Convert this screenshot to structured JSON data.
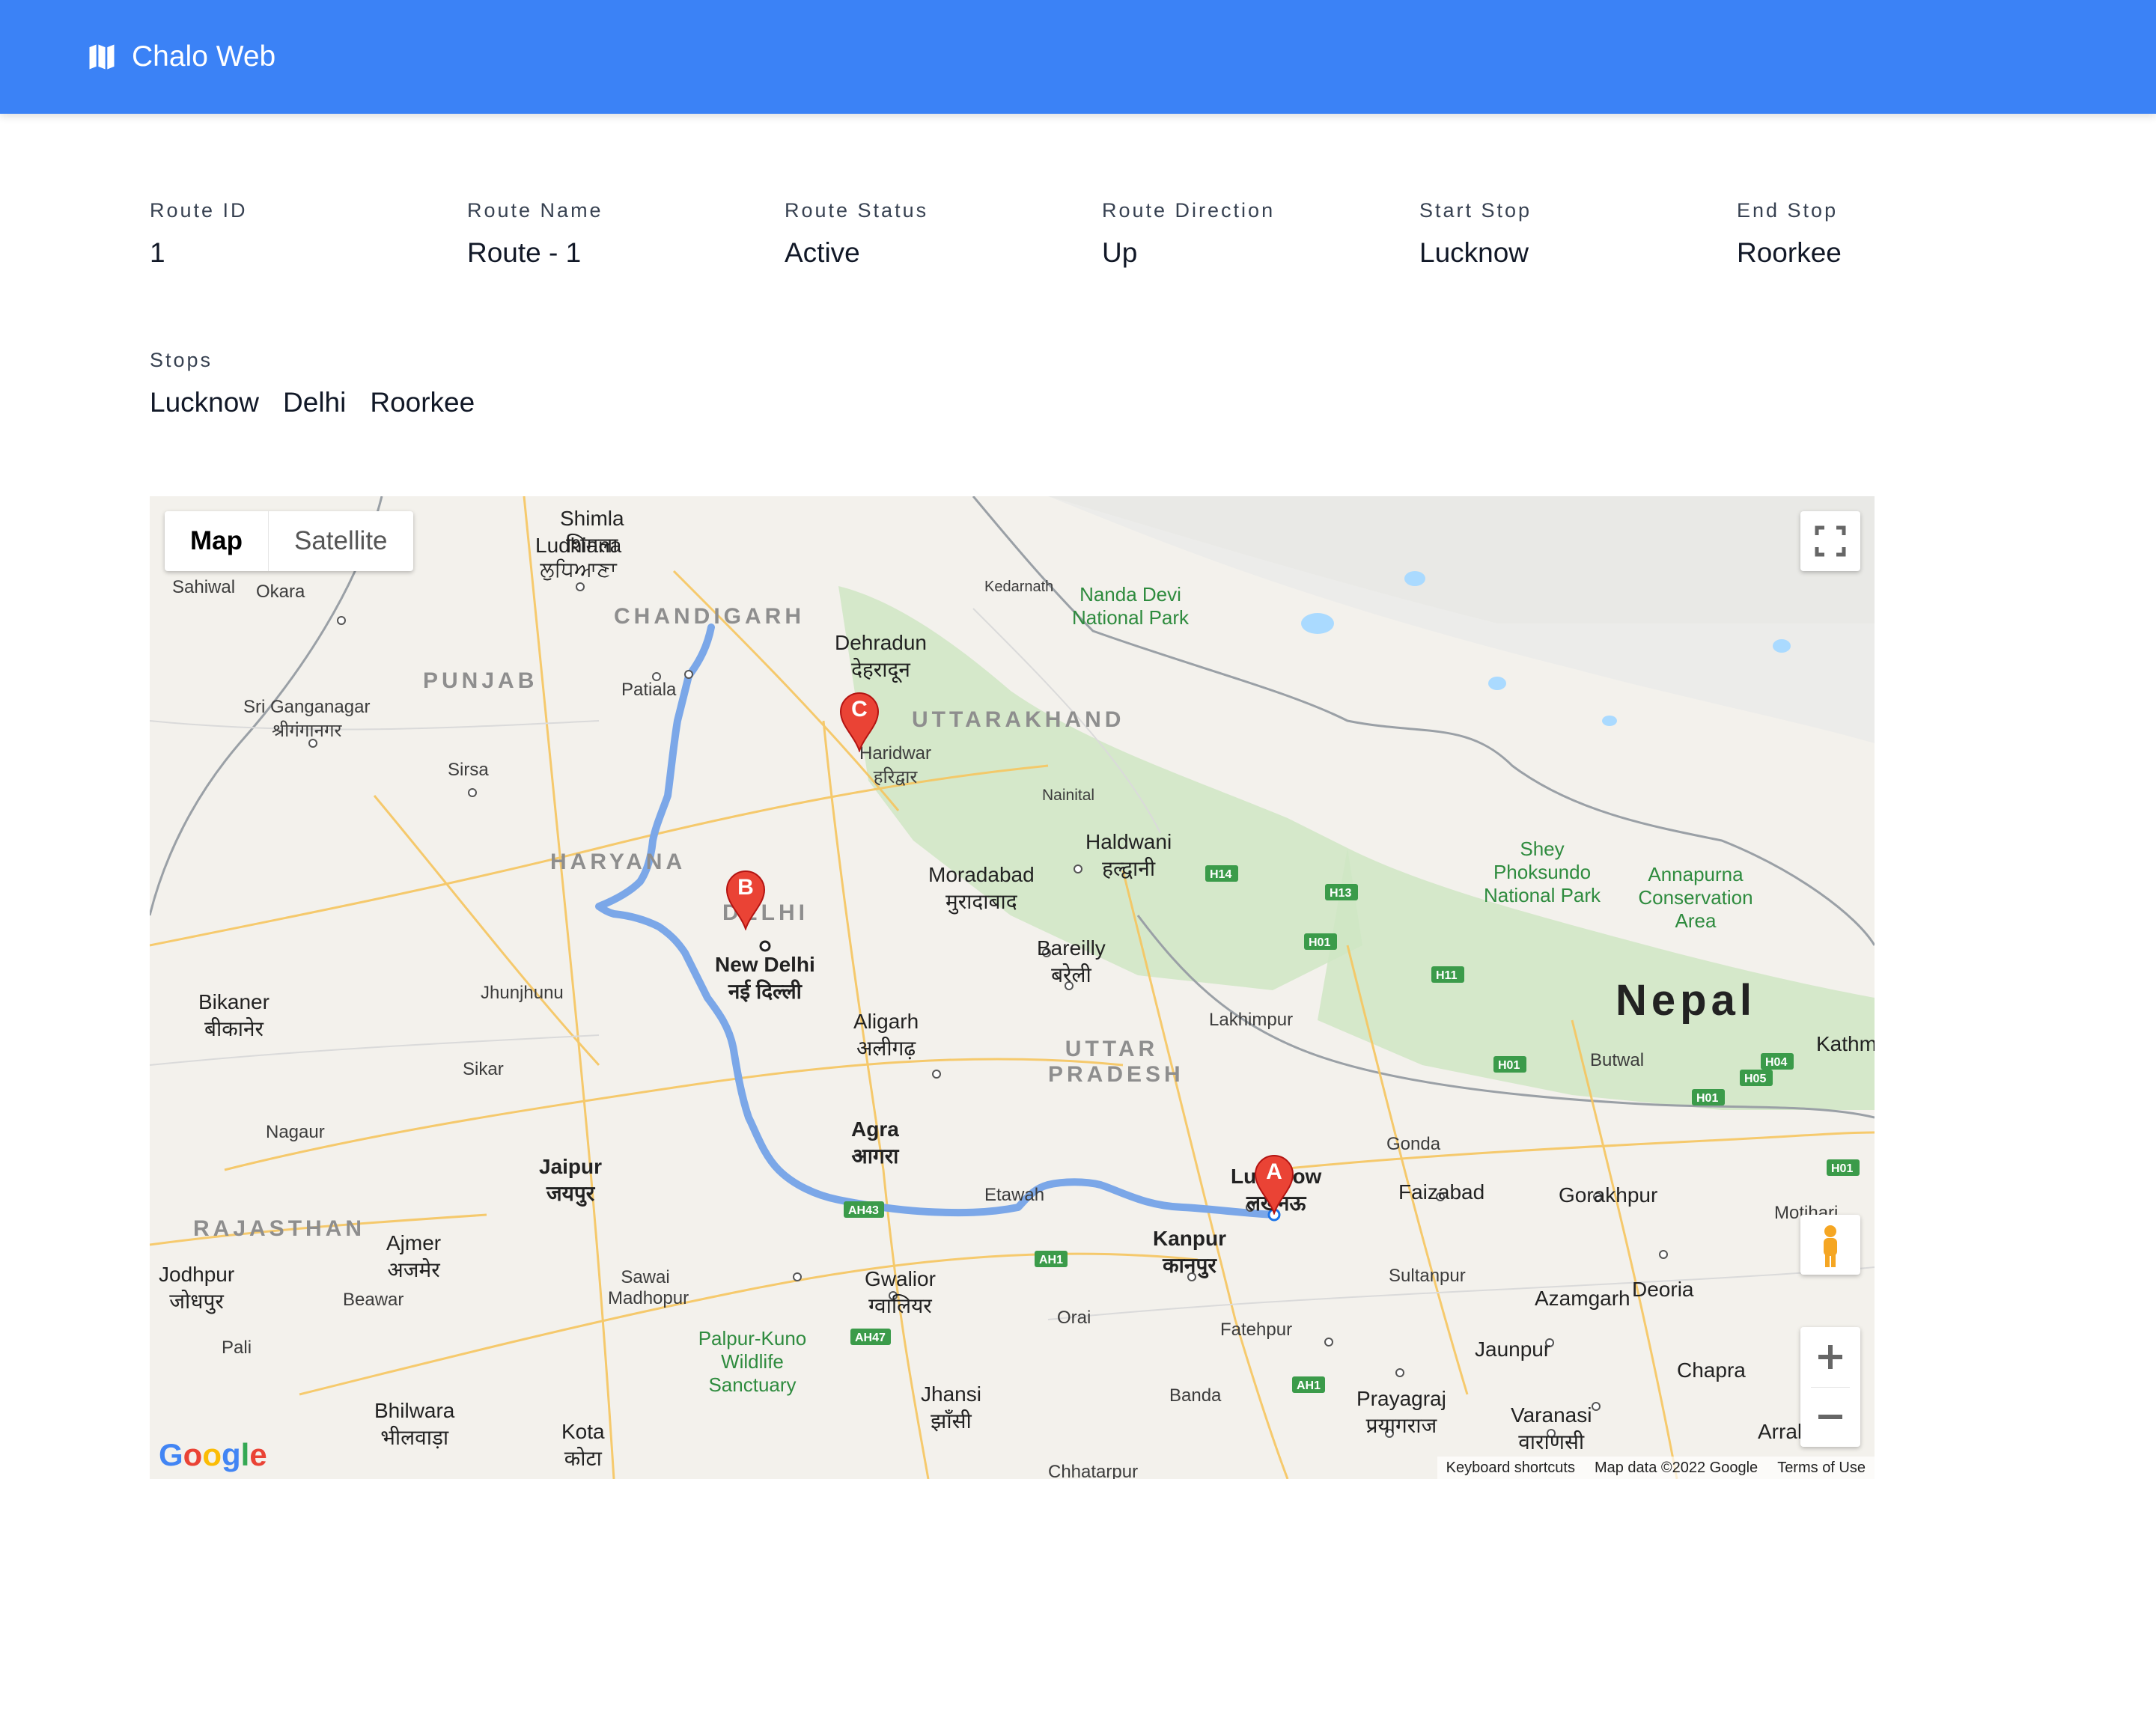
{
  "app": {
    "title": "Chalo Web"
  },
  "route_info": [
    {
      "label": "Route ID",
      "value": "1"
    },
    {
      "label": "Route Name",
      "value": "Route - 1"
    },
    {
      "label": "Route Status",
      "value": "Active"
    },
    {
      "label": "Route Direction",
      "value": "Up"
    },
    {
      "label": "Start Stop",
      "value": "Lucknow"
    },
    {
      "label": "End Stop",
      "value": "Roorkee"
    }
  ],
  "stops": {
    "label": "Stops",
    "items": [
      "Lucknow",
      "Delhi",
      "Roorkee"
    ]
  },
  "map": {
    "type_control": {
      "map": "Map",
      "satellite": "Satellite"
    },
    "markers": {
      "a": "A",
      "b": "B",
      "c": "C"
    },
    "labels": {
      "shimla": "Shimla",
      "shimla_hi": "शिमला",
      "ludhiana": "Ludhiana",
      "ludhiana_pa": "ਲੁਧਿਆਣਾ",
      "sahiwal": "Sahiwal",
      "okara": "Okara",
      "chandigarh": "CHANDIGARH",
      "punjab": "PUNJAB",
      "patiala": "Patiala",
      "dehradun": "Dehradun",
      "dehradun_hi": "देहरादून",
      "uttarakhand": "UTTARAKHAND",
      "kedarnath": "Kedarnath",
      "nanda_devi": "Nanda Devi National Park",
      "sri_ganganagar": "Sri Ganganagar",
      "sri_ganganagar_hi": "श्रीगंगानगर",
      "sirsa": "Sirsa",
      "haridwar": "Haridwar",
      "haridwar_hi": "हरिद्वार",
      "nainital": "Nainital",
      "haldwani": "Haldwani",
      "haldwani_hi": "हल्द्वानी",
      "haryana": "HARYANA",
      "moradabad": "Moradabad",
      "moradabad_hi": "मुरादाबाद",
      "delhi": "DELHI",
      "new_delhi": "New Delhi",
      "new_delhi_hi": "नई दिल्ली",
      "bareilly": "Bareilly",
      "bareilly_hi": "बरेली",
      "shey": "Shey Phoksundo National Park",
      "annapurna": "Annapurna Conservation Area",
      "nepal": "Nepal",
      "bikaner": "Bikaner",
      "bikaner_hi": "बीकानेर",
      "jhunjhunu": "Jhunjhunu",
      "aligarh": "Aligarh",
      "aligarh_hi": "अलीगढ़",
      "uttar_pradesh": "UTTAR PRADESH",
      "lakhimpur": "Lakhimpur",
      "butwal": "Butwal",
      "kathmandu": "Kathm",
      "sikar": "Sikar",
      "agra": "Agra",
      "agra_hi": "आगरा",
      "nagaur": "Nagaur",
      "jaipur": "Jaipur",
      "jaipur_hi": "जयपुर",
      "etawah": "Etawah",
      "lucknow": "Lucknow",
      "lucknow_hi": "लखनऊ",
      "gonda": "Gonda",
      "faizabad": "Faizabad",
      "gorakhpur": "Gorakhpur",
      "rajasthan": "RAJASTHAN",
      "ajmer": "Ajmer",
      "ajmer_hi": "अजमेर",
      "kanpur": "Kanpur",
      "kanpur_hi": "कानपुर",
      "jodhpur": "Jodhpur",
      "jodhpur_hi": "जोधपुर",
      "sawai_madhopur": "Sawai Madhopur",
      "gwalior": "Gwalior",
      "gwalior_hi": "ग्वालियर",
      "sultanpur": "Sultanpur",
      "azamgarh": "Azamgarh",
      "deoria": "Deoria",
      "beawar": "Beawar",
      "palpur_kuno": "Palpur-Kuno Wildlife Sanctuary",
      "orai": "Orai",
      "fatehpur": "Fatehpur",
      "pali": "Pali",
      "jaunpur": "Jaunpur",
      "chapra": "Chapra",
      "bhilwara": "Bhilwara",
      "bhilwara_hi": "भीलवाड़ा",
      "kota": "Kota",
      "kota_hi": "कोटा",
      "jhansi": "Jhansi",
      "jhansi_hi": "झाँसी",
      "banda": "Banda",
      "prayagraj": "Prayagraj",
      "prayagraj_hi": "प्रयागराज",
      "varanasi": "Varanasi",
      "varanasi_hi": "वाराणसी",
      "arrah": "Arrah",
      "motihari": "Motihari",
      "chhatarpur": "Chhatarpur"
    },
    "footer": {
      "shortcuts": "Keyboard shortcuts",
      "map_data": "Map data ©2022 Google",
      "terms": "Terms of Use"
    },
    "logo": "Google",
    "colors": {
      "route": "#7ba7e8",
      "marker": "#ea4335",
      "park": "#cfe6c4",
      "road": "#f6c55f"
    }
  }
}
